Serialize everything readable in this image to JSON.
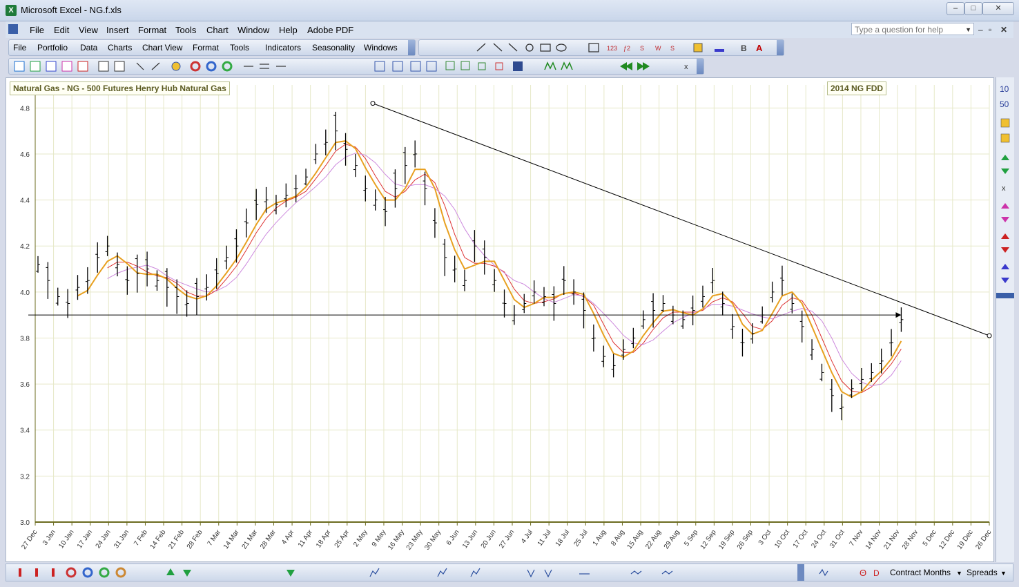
{
  "window": {
    "title": "Microsoft Excel - NG.f.xls",
    "app_icon": "X"
  },
  "menubar": {
    "items": [
      "File",
      "Edit",
      "View",
      "Insert",
      "Format",
      "Tools",
      "Chart",
      "Window",
      "Help",
      "Adobe PDF"
    ],
    "help_placeholder": "Type a question for help"
  },
  "toolbar1": {
    "menus": [
      "File",
      "Portfolio",
      "Data",
      "Charts",
      "Chart View",
      "Format",
      "Tools",
      "Indicators",
      "Seasonality",
      "Windows"
    ]
  },
  "chart": {
    "title": "Natural Gas - NG - 500 Futures Henry Hub Natural Gas",
    "fdd_label": "2014 NG FDD"
  },
  "sidebar": {
    "numbers": [
      "10",
      "50"
    ]
  },
  "bottombar": {
    "contract_months": "Contract Months",
    "spreads": "Spreads"
  },
  "colors": {
    "accent": "#3a5fa8",
    "price_bars": "#000000",
    "ma_fast": "#e8a020",
    "ma_mid": "#cc88dd",
    "ma_slow": "#dd3333",
    "grid": "#e6e8c8",
    "axis": "#6b6b1e"
  },
  "chart_data": {
    "type": "bar",
    "y_ticks": [
      "4.8",
      "4.6",
      "4.4",
      "4.2",
      "4.0",
      "3.8",
      "3.6",
      "3.4",
      "3.2",
      "3.0"
    ],
    "ylim": [
      3.0,
      4.9
    ],
    "x_ticks": [
      "27 Dec",
      "3 Jan",
      "10 Jan",
      "17 Jan",
      "24 Jan",
      "31 Jan",
      "7 Feb",
      "14 Feb",
      "21 Feb",
      "28 Feb",
      "7 Mar",
      "14 Mar",
      "21 Mar",
      "28 Mar",
      "4 Apr",
      "11 Apr",
      "18 Apr",
      "25 Apr",
      "2 May",
      "9 May",
      "16 May",
      "23 May",
      "30 May",
      "6 Jun",
      "13 Jun",
      "20 Jun",
      "27 Jun",
      "4 Jul",
      "11 Jul",
      "18 Jul",
      "25 Jul",
      "1 Aug",
      "8 Aug",
      "15 Aug",
      "22 Aug",
      "29 Aug",
      "5 Sep",
      "12 Sep",
      "19 Sep",
      "26 Sep",
      "3 Oct",
      "10 Oct",
      "17 Oct",
      "24 Oct",
      "31 Oct",
      "7 Nov",
      "14 Nov",
      "21 Nov",
      "28 Nov",
      "5 Dec",
      "12 Dec",
      "19 Dec",
      "26 Dec"
    ],
    "price_closes": [
      4.12,
      4.05,
      3.98,
      3.95,
      4.02,
      4.05,
      4.15,
      4.2,
      4.12,
      4.05,
      4.08,
      4.1,
      4.05,
      4.02,
      3.98,
      3.95,
      3.98,
      4.02,
      4.08,
      4.15,
      4.2,
      4.3,
      4.38,
      4.4,
      4.38,
      4.42,
      4.45,
      4.5,
      4.6,
      4.65,
      4.7,
      4.62,
      4.55,
      4.45,
      4.4,
      4.35,
      4.45,
      4.55,
      4.6,
      4.45,
      4.3,
      4.15,
      4.1,
      4.05,
      4.2,
      4.15,
      4.05,
      3.95,
      3.9,
      3.95,
      4.0,
      3.98,
      3.95,
      4.05,
      4.0,
      3.92,
      3.8,
      3.72,
      3.68,
      3.75,
      3.8,
      3.88,
      3.92,
      3.95,
      3.9,
      3.88,
      3.92,
      3.98,
      4.05,
      3.95,
      3.85,
      3.78,
      3.82,
      3.9,
      4.0,
      4.05,
      3.95,
      3.85,
      3.75,
      3.65,
      3.55,
      3.5,
      3.58,
      3.62,
      3.65,
      3.7,
      3.78,
      3.88
    ],
    "trendline": {
      "from_value": 4.82,
      "to_value": 3.81
    },
    "support_line": 3.9,
    "series": [
      {
        "name": "",
        "type": "moving-average-fast"
      },
      {
        "name": "",
        "type": "moving-average-mid"
      },
      {
        "name": "",
        "type": "moving-average-slow"
      }
    ]
  }
}
